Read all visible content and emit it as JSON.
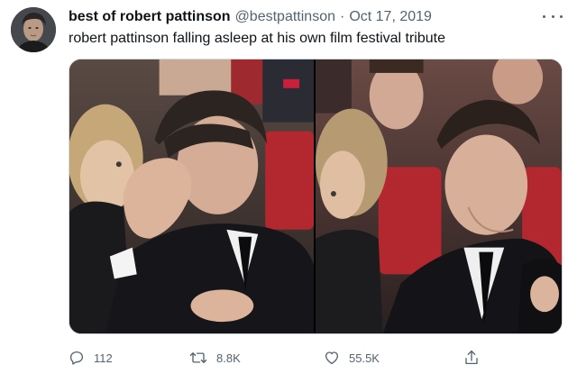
{
  "tweet": {
    "display_name": "best of robert pattinson",
    "handle": "@bestpattinson",
    "separator": "·",
    "date": "Oct 17, 2019",
    "text": "robert pattinson falling asleep at his own film festival tribute"
  },
  "actions": {
    "reply_count": "112",
    "retweet_count": "8.8K",
    "like_count": "55.5K"
  },
  "icons": {
    "more": "more-horizontal-icon",
    "reply": "reply-icon",
    "retweet": "retweet-icon",
    "like": "heart-icon",
    "share": "share-icon"
  },
  "colors": {
    "text_primary": "#0f1419",
    "text_secondary": "#536471",
    "border": "#cfd9de",
    "seat_red": "#b3272f"
  }
}
